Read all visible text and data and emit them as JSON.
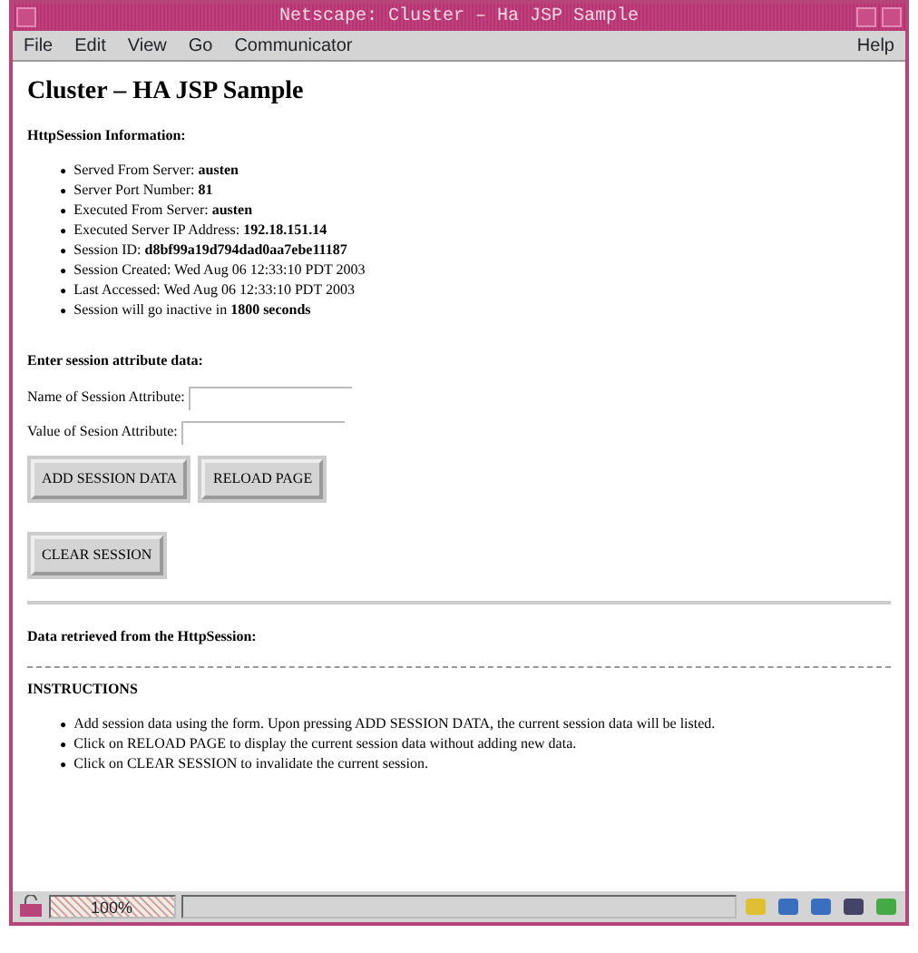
{
  "window": {
    "title": "Netscape: Cluster – Ha JSP Sample"
  },
  "menu": [
    "File",
    "Edit",
    "View",
    "Go",
    "Communicator"
  ],
  "help_menu": "Help",
  "page": {
    "heading": "Cluster – HA JSP Sample",
    "bullet": "●",
    "session_heading": "HttpSession Information:",
    "session_info": [
      "Served From Server: **austen**",
      "Server Port Number: **81**",
      "Executed From Server: **austen**",
      "Executed Server IP Address: **192.18.151.14**",
      "Session ID: **d8bf99a19d794dad0aa7ebe11187**",
      "Session Created: Wed Aug 06 12:33:10 PDT 2003",
      "Last Accessed: Wed Aug 06 12:33:10 PDT 2003",
      "Session will go inactive in **1800 seconds**"
    ],
    "form_heading": "Enter session attribute data:",
    "fields": [
      {
        "label": "Name of Session Attribute:"
      },
      {
        "label": "Value of Sesion Attribute:"
      }
    ],
    "buttons": [
      "ADD SESSION DATA",
      "RELOAD PAGE"
    ],
    "clear_button": "CLEAR SESSION",
    "retrieved_heading": "Data retrieved from the HttpSession:",
    "instructions_heading": "INSTRUCTIONS",
    "instructions": [
      "Add session data using the form. Upon pressing ADD SESSION DATA, the current session data will be listed.",
      "Click on RELOAD PAGE to display the current session data without adding new data.",
      "Click on CLEAR SESSION to invalidate the current session."
    ]
  },
  "status_bar": {
    "progress": "100%",
    "level": 1
  }
}
